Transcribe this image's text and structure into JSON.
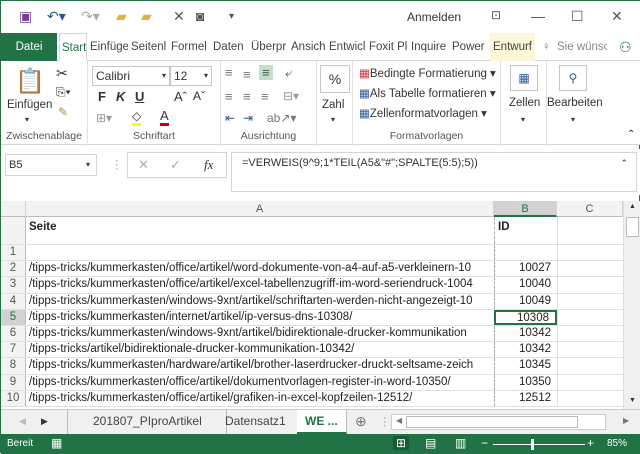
{
  "titlebar": {
    "sign_in": "Anmelden"
  },
  "tabs": [
    "Datei",
    "Start",
    "Einfüge",
    "Seitenl",
    "Formel",
    "Daten",
    "Überpr",
    "Ansich",
    "Entwicl",
    "Foxit Pl",
    "Inquire",
    "Power",
    "Entwurf"
  ],
  "tell_me": "Sie wünsc",
  "ribbon": {
    "clipboard": {
      "paste": "Einfügen",
      "label": "Zwischenablage"
    },
    "font": {
      "name": "Calibri",
      "size": "12",
      "bold": "F",
      "italic": "K",
      "underline": "U",
      "label": "Schriftart"
    },
    "alignment": {
      "label": "Ausrichtung"
    },
    "number": {
      "symbol": "%",
      "label": "Zahl"
    },
    "styles": {
      "conditional": "Bedingte Formatierung",
      "as_table": "Als Tabelle formatieren",
      "cell_styles": "Zellenformatvorlagen",
      "label": "Formatvorlagen"
    },
    "cells": {
      "label": "Zellen"
    },
    "editing": {
      "label": "Bearbeiten"
    }
  },
  "formula_bar": {
    "name_box": "B5",
    "fx": "fx",
    "formula": "=VERWEIS(9^9;1*TEIL(A5&\"#\";SPALTE(5:5);5))"
  },
  "columns": [
    "A",
    "B",
    "C"
  ],
  "header_row": {
    "a": "Seite",
    "b": "ID"
  },
  "rows": [
    {
      "n": "1",
      "a": "",
      "b": ""
    },
    {
      "n": "2",
      "a": "/tipps-tricks/kummerkasten/office/artikel/word-dokumente-von-a4-auf-a5-verkleinern-10",
      "b": "10027"
    },
    {
      "n": "3",
      "a": "/tipps-tricks/kummerkasten/office/artikel/excel-tabellenzugriff-im-word-seriendruck-1004",
      "b": "10040"
    },
    {
      "n": "4",
      "a": "/tipps-tricks/kummerkasten/windows-9xnt/artikel/schriftarten-werden-nicht-angezeigt-10",
      "b": "10049"
    },
    {
      "n": "5",
      "a": "/tipps-tricks/kummerkasten/internet/artikel/ip-versus-dns-10308/",
      "b": "10308"
    },
    {
      "n": "6",
      "a": "/tipps-tricks/kummerkasten/windows-9xnt/artikel/bidirektionale-drucker-kommunikation",
      "b": "10342"
    },
    {
      "n": "7",
      "a": "/tipps-tricks/artikel/bidirektionale-drucker-kommunikation-10342/",
      "b": "10342"
    },
    {
      "n": "8",
      "a": "/tipps-tricks/kummerkasten/hardware/artikel/brother-laserdrucker-druckt-seltsame-zeich",
      "b": "10345"
    },
    {
      "n": "9",
      "a": "/tipps-tricks/kummerkasten/office/artikel/dokumentvorlagen-register-in-word-10350/",
      "b": "10350"
    },
    {
      "n": "10",
      "a": "/tipps-tricks/kummerkasten/office/artikel/grafiken-in-excel-kopfzeilen-12512/",
      "b": "12512"
    }
  ],
  "sheets": [
    "201807_PIproArtikel",
    "Datensatz1",
    "WE ..."
  ],
  "status": {
    "ready": "Bereit",
    "zoom": "85%"
  }
}
